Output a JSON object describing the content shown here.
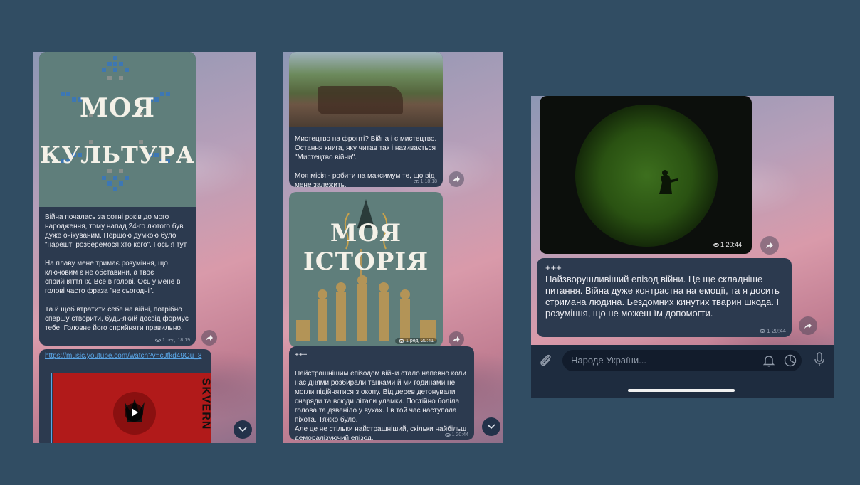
{
  "panel1": {
    "image_title_line1": "МОЯ",
    "image_title_line2": "КУЛЬТУРА",
    "message_text": "Війна почалась за сотні років до мого народження, тому напад 24-го лютого був дуже очікуваним. Першою думкою було \"нарешті розберемося хто кого\". І ось я тут.\n\nНа плаву мене тримає розуміння, що ключовим є не обставини, а твоє сприйняття їх. Все в голові. Ось у мене в голові часто фраза \"не сьогодні\".\n\nТа й щоб втратити себе на війні, потрібно спершу створити, будь-який досвід формує тебе. Головне його сприйняти правильно.",
    "message_meta": "1 ред. 18:19",
    "link_text": "https://music.youtube.com/watch?v=cJfkd49Ou_8",
    "video_side_text": "SKVERN"
  },
  "panel2": {
    "message1_text": "Мистецтво на фронті? Війна і є мистецтво. Остання книга, яку читав так і називається \"Мистецтво війни\".\n\nМоя місія - робити на максимум те, що від мене залежить.",
    "message1_meta": "1 18:18",
    "image_title_line1": "МОЯ",
    "image_title_line2": "ІСТОРІЯ",
    "image_meta": "1 ред. 20:41",
    "message2_text": "+++\n\nНайстрашнішим епізодом війни стало напевно коли нас днями розбирали танками й ми годинами не могли підійнятися з окопу. Від дерев детонували снаряди та всюди літали уламки. Постійно боліла голова та дзвеніло у вухах. І в той час наступала піхота. Тяжко було.\nАле це не стільки найстрашніший, скільки найбільш деморалізуючий епізод.",
    "message2_meta": "1 20:44"
  },
  "panel3": {
    "image_meta": "1 20:44",
    "message_text": "+++\nНайзворушливіший епізод війни. Це ще складніше питання. Війна дуже контрастна на емоції, та я досить стримана людина. Бездомних кинутих тварин шкода. І розуміння, що не можеш їм допомогти.",
    "message_meta": "1 20:44",
    "input_placeholder": "Народе України..."
  },
  "colors": {
    "background": "#314d63",
    "bubble": "#2c3a4f",
    "link": "#5aa6e6",
    "night_vision": "#3d6f1e"
  }
}
